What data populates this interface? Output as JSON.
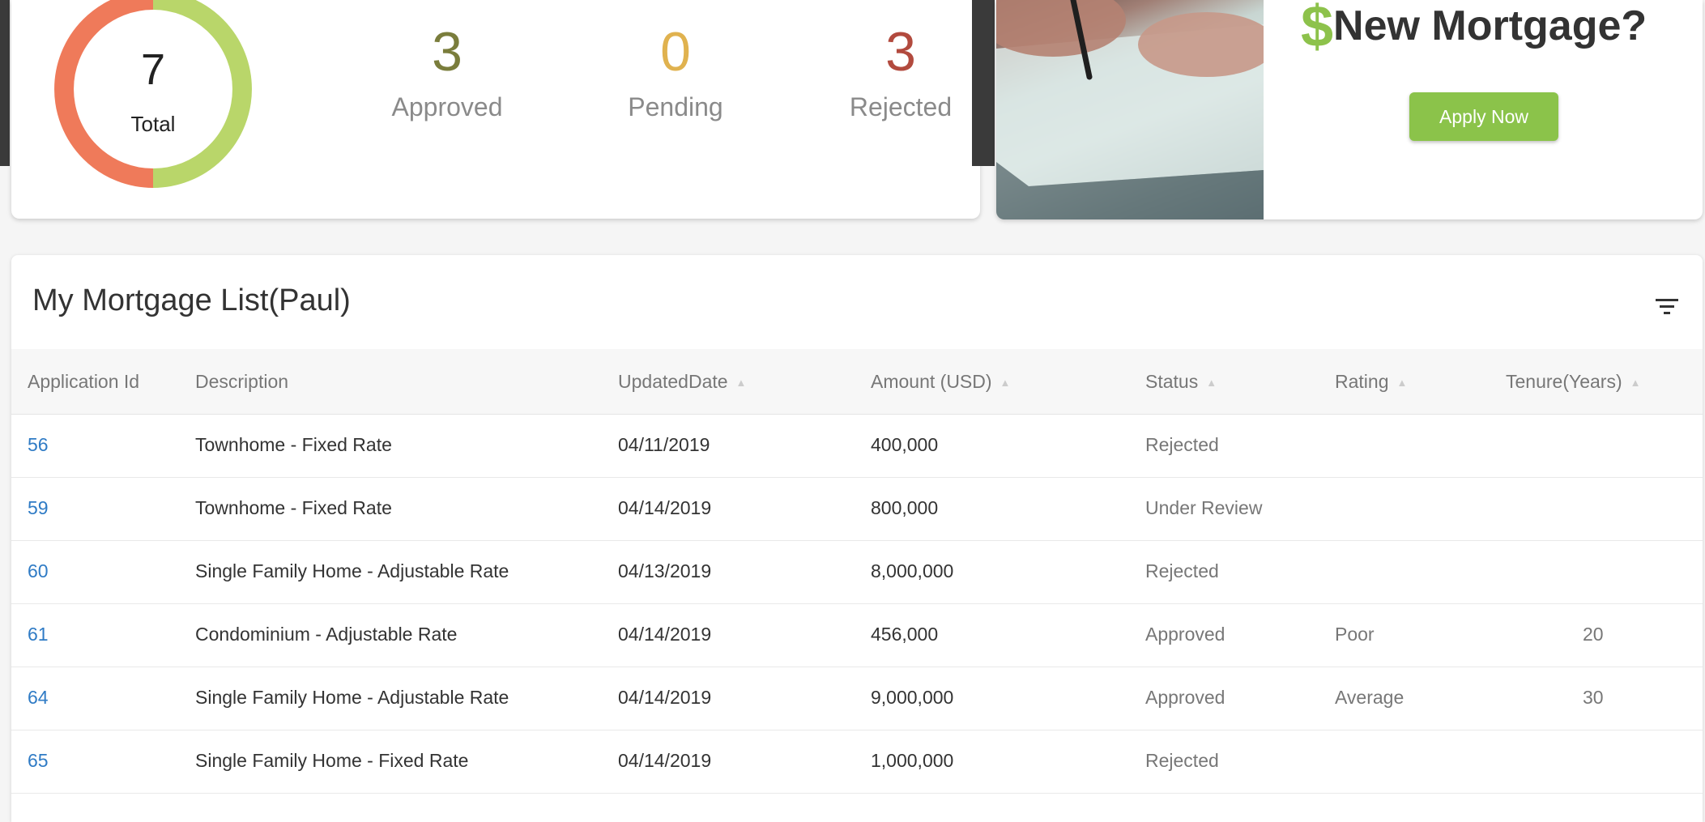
{
  "summary": {
    "total_count": "7",
    "total_label": "Total",
    "donut": {
      "approved": 3,
      "pending": 0,
      "rejected": 3,
      "total": 7
    },
    "colors": {
      "approved": "#b9d66a",
      "rejected": "#ef7a5a"
    },
    "approved": {
      "count": "3",
      "label": "Approved",
      "color": "#7a7d3c"
    },
    "pending": {
      "count": "0",
      "label": "Pending",
      "color": "#e0b24f"
    },
    "rejected": {
      "count": "3",
      "label": "Rejected",
      "color": "#b24a3e"
    }
  },
  "promo": {
    "dollar_sign": "$",
    "title": "New Mortgage?",
    "button_label": "Apply Now",
    "accent": "#8bc34a"
  },
  "list": {
    "title": "My Mortgage List(Paul)",
    "filter_icon": "filter-icon",
    "columns": [
      "Application Id",
      "Description",
      "UpdatedDate",
      "Amount (USD)",
      "Status",
      "Rating",
      "Tenure(Years)"
    ],
    "rows": [
      {
        "id": "56",
        "description": "Townhome - Fixed Rate",
        "updated": "04/11/2019",
        "amount": "400,000",
        "status": "Rejected",
        "rating": "",
        "tenure": ""
      },
      {
        "id": "59",
        "description": "Townhome - Fixed Rate",
        "updated": "04/14/2019",
        "amount": "800,000",
        "status": "Under Review",
        "rating": "",
        "tenure": ""
      },
      {
        "id": "60",
        "description": "Single Family Home - Adjustable Rate",
        "updated": "04/13/2019",
        "amount": "8,000,000",
        "status": "Rejected",
        "rating": "",
        "tenure": ""
      },
      {
        "id": "61",
        "description": "Condominium - Adjustable Rate",
        "updated": "04/14/2019",
        "amount": "456,000",
        "status": "Approved",
        "rating": "Poor",
        "tenure": "20"
      },
      {
        "id": "64",
        "description": "Single Family Home - Adjustable Rate",
        "updated": "04/14/2019",
        "amount": "9,000,000",
        "status": "Approved",
        "rating": "Average",
        "tenure": "30"
      },
      {
        "id": "65",
        "description": "Single Family Home - Fixed Rate",
        "updated": "04/14/2019",
        "amount": "1,000,000",
        "status": "Rejected",
        "rating": "",
        "tenure": ""
      }
    ]
  }
}
